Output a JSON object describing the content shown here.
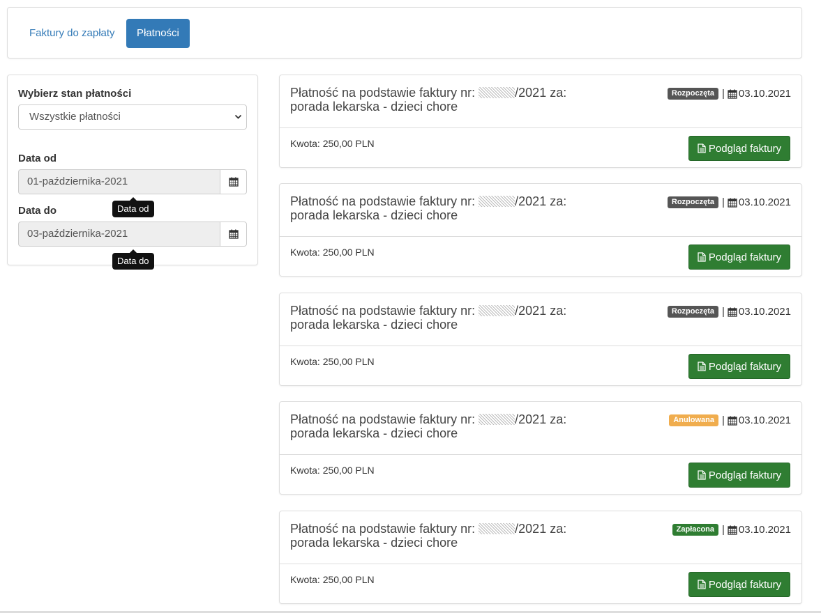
{
  "tabs": [
    {
      "label": "Faktury do zapłaty",
      "active": false
    },
    {
      "label": "Płatności",
      "active": true
    }
  ],
  "filters": {
    "status_label": "Wybierz stan płatności",
    "status_value": "Wszystkie płatności",
    "date_from_label": "Data od",
    "date_from_value": "01-października-2021",
    "date_from_tooltip": "Data od",
    "date_to_label": "Data do",
    "date_to_value": "03-października-2021",
    "date_to_tooltip": "Data do"
  },
  "payments": [
    {
      "title_prefix": "Płatność na podstawie faktury nr:",
      "title_suffix": "/2021 za:",
      "title_line2": "porada lekarska - dzieci chore",
      "status": "Rozpoczęta",
      "status_color": "#555555",
      "date": "03.10.2021",
      "amount": "Kwota: 250,00 PLN",
      "button": "Podgląd faktury"
    },
    {
      "title_prefix": "Płatność na podstawie faktury nr:",
      "title_suffix": "/2021 za:",
      "title_line2": "porada lekarska - dzieci chore",
      "status": "Rozpoczęta",
      "status_color": "#555555",
      "date": "03.10.2021",
      "amount": "Kwota: 250,00 PLN",
      "button": "Podgląd faktury"
    },
    {
      "title_prefix": "Płatność na podstawie faktury nr:",
      "title_suffix": "/2021 za:",
      "title_line2": "porada lekarska - dzieci chore",
      "status": "Rozpoczęta",
      "status_color": "#555555",
      "date": "03.10.2021",
      "amount": "Kwota: 250,00 PLN",
      "button": "Podgląd faktury"
    },
    {
      "title_prefix": "Płatność na podstawie faktury nr:",
      "title_suffix": "/2021 za:",
      "title_line2": "porada lekarska - dzieci chore",
      "status": "Anulowana",
      "status_color": "#f0ad4e",
      "date": "03.10.2021",
      "amount": "Kwota: 250,00 PLN",
      "button": "Podgląd faktury"
    },
    {
      "title_prefix": "Płatność na podstawie faktury nr:",
      "title_suffix": "/2021 za:",
      "title_line2": "porada lekarska - dzieci chore",
      "status": "Zapłacona",
      "status_color": "#2f7d32",
      "date": "03.10.2021",
      "amount": "Kwota: 250,00 PLN",
      "button": "Podgląd faktury"
    }
  ],
  "colors": {
    "primary": "#337ab7",
    "success": "#2f7d32"
  },
  "icons": {
    "date": "calendar-icon",
    "invoice": "file-icon",
    "dropdown": "chevron-down-icon"
  }
}
